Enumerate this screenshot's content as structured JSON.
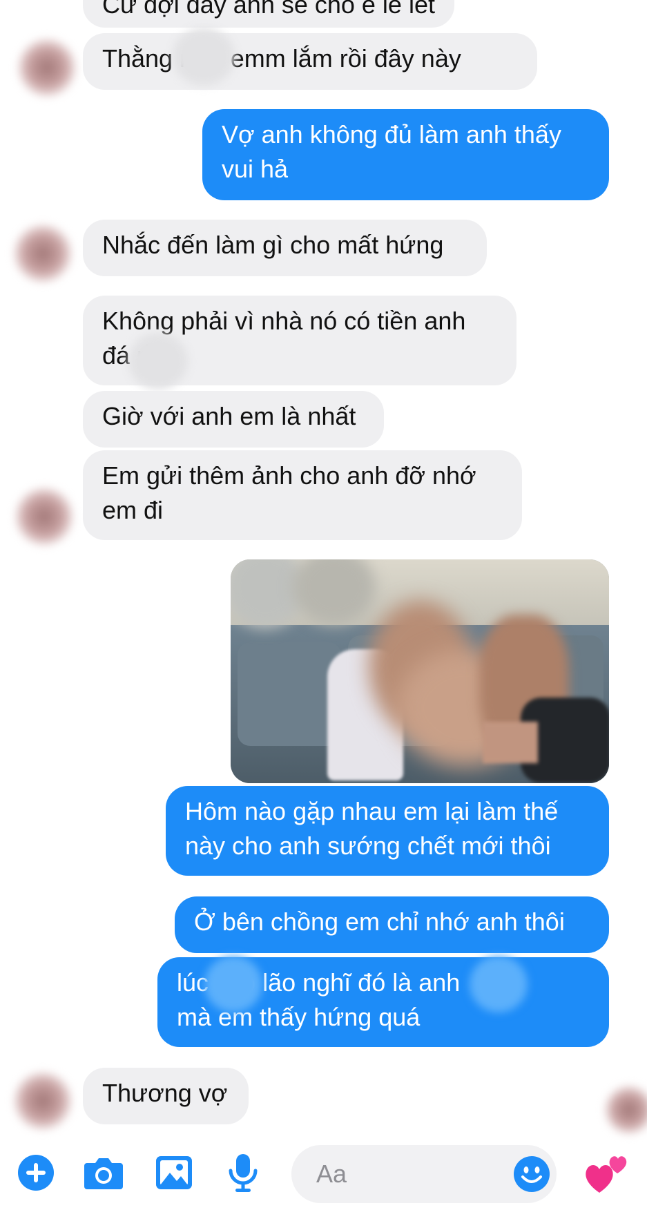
{
  "messages": [
    {
      "type": "in",
      "text": "Cứ đợi đấy anh sẽ cho e lê lết"
    },
    {
      "type": "in",
      "text": "Thằng     nhớ emm lắm rồi đây này"
    },
    {
      "type": "out",
      "text": "Vợ anh không đủ làm anh thấy\nvui hả"
    },
    {
      "type": "in",
      "text": "Nhắc đến làm gì cho mất hứng"
    },
    {
      "type": "in",
      "text": "Không phải vì nhà nó có tiền anh\nđá        rồi"
    },
    {
      "type": "in",
      "text": "Giờ với anh em là nhất"
    },
    {
      "type": "in",
      "text": "Em gửi thêm ảnh cho anh đỡ nhớ\nem đi"
    },
    {
      "type": "out",
      "text": "Hôm nào gặp nhau em lại làm thế\nnày cho anh sướng chết mới thôi"
    },
    {
      "type": "out",
      "text": "Ở bên chồng em chỉ nhớ anh thôi"
    },
    {
      "type": "out",
      "text": "lúc       cho lão nghĩ đó là        anh\nmà em thấy hứng quá"
    },
    {
      "type": "in",
      "text": "Thương vợ"
    }
  ],
  "composer": {
    "placeholder": "Aa",
    "icons": [
      "plus-icon",
      "camera-icon",
      "image-icon",
      "microphone-icon",
      "emoji-icon",
      "hearts-icon"
    ]
  },
  "colors": {
    "incoming_bubble": "#efeff1",
    "outgoing_bubble": "#1d8cf8",
    "accent": "#1d8cf8"
  }
}
